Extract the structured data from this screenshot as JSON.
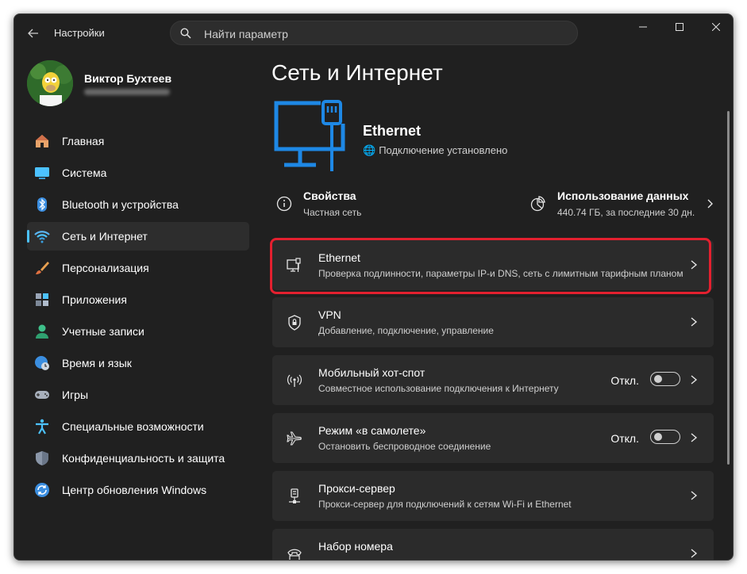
{
  "app": {
    "title": "Настройки"
  },
  "search": {
    "placeholder": "Найти параметр"
  },
  "user": {
    "name": "Виктор Бухтеев"
  },
  "nav": [
    {
      "label": "Главная",
      "icon": "home-icon"
    },
    {
      "label": "Система",
      "icon": "system-icon"
    },
    {
      "label": "Bluetooth и устройства",
      "icon": "bluetooth-icon"
    },
    {
      "label": "Сеть и Интернет",
      "icon": "wifi-icon",
      "active": true
    },
    {
      "label": "Персонализация",
      "icon": "brush-icon"
    },
    {
      "label": "Приложения",
      "icon": "apps-icon"
    },
    {
      "label": "Учетные записи",
      "icon": "account-icon"
    },
    {
      "label": "Время и язык",
      "icon": "globe-clock-icon"
    },
    {
      "label": "Игры",
      "icon": "gamepad-icon"
    },
    {
      "label": "Специальные возможности",
      "icon": "accessibility-icon"
    },
    {
      "label": "Конфиденциальность и защита",
      "icon": "shield-icon"
    },
    {
      "label": "Центр обновления Windows",
      "icon": "update-icon"
    }
  ],
  "main": {
    "title": "Сеть и Интернет",
    "connection": {
      "name": "Ethernet",
      "status": "Подключение установлено"
    },
    "properties": {
      "title": "Свойства",
      "subtitle": "Частная сеть"
    },
    "data_usage": {
      "title": "Использование данных",
      "subtitle": "440.74 ГБ, за последние 30 дн."
    },
    "cards": [
      {
        "title": "Ethernet",
        "subtitle": "Проверка подлинности, параметры IP-и DNS, сеть с лимитным тарифным планом",
        "icon": "ethernet-icon"
      },
      {
        "title": "VPN",
        "subtitle": "Добавление, подключение, управление",
        "icon": "vpn-shield-icon"
      },
      {
        "title": "Мобильный хот-спот",
        "subtitle": "Совместное использование подключения к Интернету",
        "icon": "hotspot-icon",
        "toggle": "Откл."
      },
      {
        "title": "Режим «в самолете»",
        "subtitle": "Остановить беспроводное соединение",
        "icon": "airplane-icon",
        "toggle": "Откл."
      },
      {
        "title": "Прокси-сервер",
        "subtitle": "Прокси-сервер для подключений к сетям Wi-Fi и Ethernet",
        "icon": "proxy-icon"
      },
      {
        "title": "Набор номера",
        "subtitle": "",
        "icon": "dialup-icon"
      }
    ]
  },
  "colors": {
    "accent": "#4cc2ff",
    "highlight": "#e3202f",
    "background": "#202020",
    "card": "#2b2b2b"
  }
}
